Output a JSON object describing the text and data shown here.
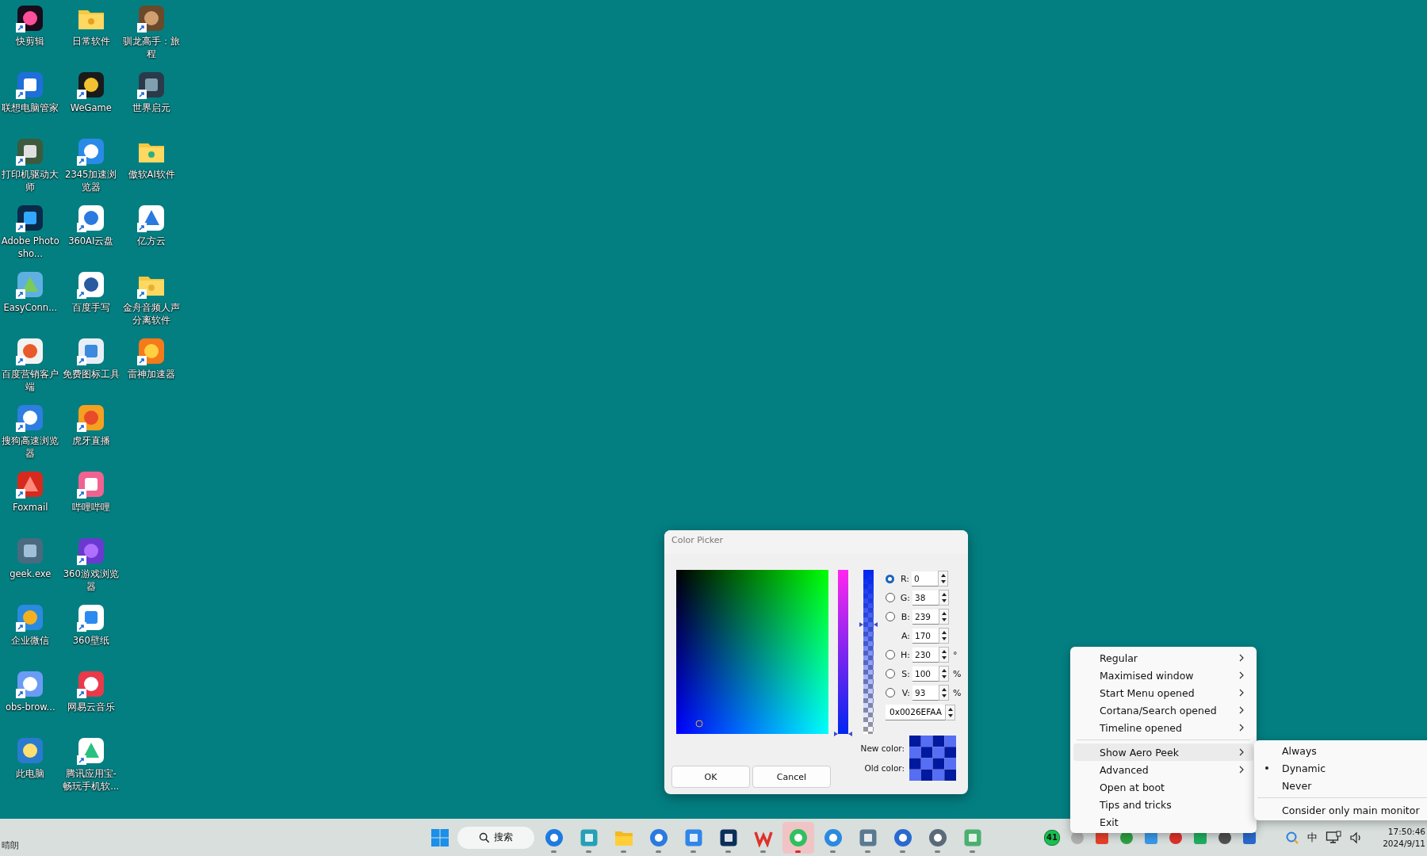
{
  "desktop_icons": [
    {
      "label": "快剪辑",
      "shortcut": true
    },
    {
      "label": "联想电脑管家",
      "shortcut": true
    },
    {
      "label": "打印机驱动大师",
      "shortcut": true
    },
    {
      "label": "Adobe Photosho...",
      "shortcut": true
    },
    {
      "label": "EasyConn...",
      "shortcut": true
    },
    {
      "label": "百度营销客户端",
      "shortcut": true
    },
    {
      "label": "搜狗高速浏览器",
      "shortcut": true
    },
    {
      "label": "Foxmail",
      "shortcut": true
    },
    {
      "label": "geek.exe",
      "shortcut": false
    },
    {
      "label": "企业微信",
      "shortcut": true
    },
    {
      "label": "obs-brow...",
      "shortcut": true
    },
    {
      "label": "此电脑",
      "shortcut": false
    },
    {
      "label": "日常软件",
      "shortcut": false
    },
    {
      "label": "WeGame",
      "shortcut": true
    },
    {
      "label": "2345加速浏览器",
      "shortcut": true
    },
    {
      "label": "360AI云盘",
      "shortcut": true
    },
    {
      "label": "百度手写",
      "shortcut": true
    },
    {
      "label": "免费图标工具",
      "shortcut": true
    },
    {
      "label": "虎牙直播",
      "shortcut": true
    },
    {
      "label": "哔哩哔哩",
      "shortcut": true
    },
    {
      "label": "360游戏浏览器",
      "shortcut": true
    },
    {
      "label": "360壁纸",
      "shortcut": true
    },
    {
      "label": "网易云音乐",
      "shortcut": true
    },
    {
      "label": "腾讯应用宝-畅玩手机软...",
      "shortcut": true
    },
    {
      "label": "驯龙高手：旅程",
      "shortcut": true
    },
    {
      "label": "世界启元",
      "shortcut": true
    },
    {
      "label": "傲软AI软件",
      "shortcut": false
    },
    {
      "label": "亿方云",
      "shortcut": true
    },
    {
      "label": "金舟音频人声分离软件",
      "shortcut": true
    },
    {
      "label": "雷神加速器",
      "shortcut": true
    }
  ],
  "color_picker": {
    "title": "Color Picker",
    "channels": [
      {
        "kind": "radio",
        "label": "R:",
        "value": "0",
        "selected": true
      },
      {
        "kind": "radio",
        "label": "G:",
        "value": "38",
        "selected": false
      },
      {
        "kind": "radio",
        "label": "B:",
        "value": "239",
        "selected": false
      },
      {
        "kind": "plain",
        "label": "A:",
        "value": "170"
      },
      {
        "kind": "radio",
        "label": "H:",
        "value": "230",
        "unit": "°",
        "selected": false
      },
      {
        "kind": "radio",
        "label": "S:",
        "value": "100",
        "unit": "%",
        "selected": false
      },
      {
        "kind": "radio",
        "label": "V:",
        "value": "93",
        "unit": "%",
        "selected": false
      }
    ],
    "channel_slider": {
      "level": 0
    },
    "alpha_slider": {
      "level": 0.667
    },
    "hex": "0x0026EFAA",
    "new_color_label": "New color:",
    "old_color_label": "Old color:",
    "buttons": [
      "OK",
      "Cancel"
    ]
  },
  "context_menu": {
    "items": [
      {
        "kind": "item",
        "label": "Regular",
        "submenu": true,
        "selected": false
      },
      {
        "kind": "item",
        "label": "Maximised window",
        "submenu": true,
        "selected": false
      },
      {
        "kind": "item",
        "label": "Start Menu opened",
        "submenu": true,
        "selected": false
      },
      {
        "kind": "item",
        "label": "Cortana/Search opened",
        "submenu": true,
        "selected": false
      },
      {
        "kind": "item",
        "label": "Timeline opened",
        "submenu": true,
        "selected": false
      },
      {
        "kind": "separator"
      },
      {
        "kind": "item",
        "label": "Show Aero Peek",
        "submenu": true,
        "selected": true
      },
      {
        "kind": "item",
        "label": "Advanced",
        "submenu": true,
        "selected": false
      },
      {
        "kind": "item",
        "label": "Open at boot",
        "submenu": false,
        "selected": false
      },
      {
        "kind": "item",
        "label": "Tips and tricks",
        "submenu": false,
        "selected": false
      },
      {
        "kind": "item",
        "label": "Exit",
        "submenu": false,
        "selected": false
      }
    ]
  },
  "submenu": {
    "items": [
      {
        "kind": "item",
        "label": "Always",
        "checked": false
      },
      {
        "kind": "item",
        "label": "Dynamic",
        "checked": true
      },
      {
        "kind": "item",
        "label": "Never",
        "checked": false
      },
      {
        "kind": "separator"
      },
      {
        "kind": "item",
        "label": "Consider only main monitor",
        "checked": false
      }
    ]
  },
  "taskbar": {
    "weather": "晴朗",
    "search": "搜索",
    "apps": [
      {
        "running": true,
        "selected": false
      },
      {
        "running": true,
        "selected": false
      },
      {
        "running": true,
        "selected": false
      },
      {
        "running": true,
        "selected": false
      },
      {
        "running": true,
        "selected": false
      },
      {
        "running": true,
        "selected": false
      },
      {
        "running": true,
        "selected": false
      },
      {
        "running": true,
        "selected": true
      },
      {
        "running": true,
        "selected": false
      },
      {
        "running": true,
        "selected": false
      },
      {
        "running": true,
        "selected": false
      },
      {
        "running": true,
        "selected": false
      },
      {
        "running": true,
        "selected": false
      }
    ],
    "tray_badge": "41",
    "ime": "中",
    "time": "17:50:46",
    "date": "2024/9/11"
  }
}
